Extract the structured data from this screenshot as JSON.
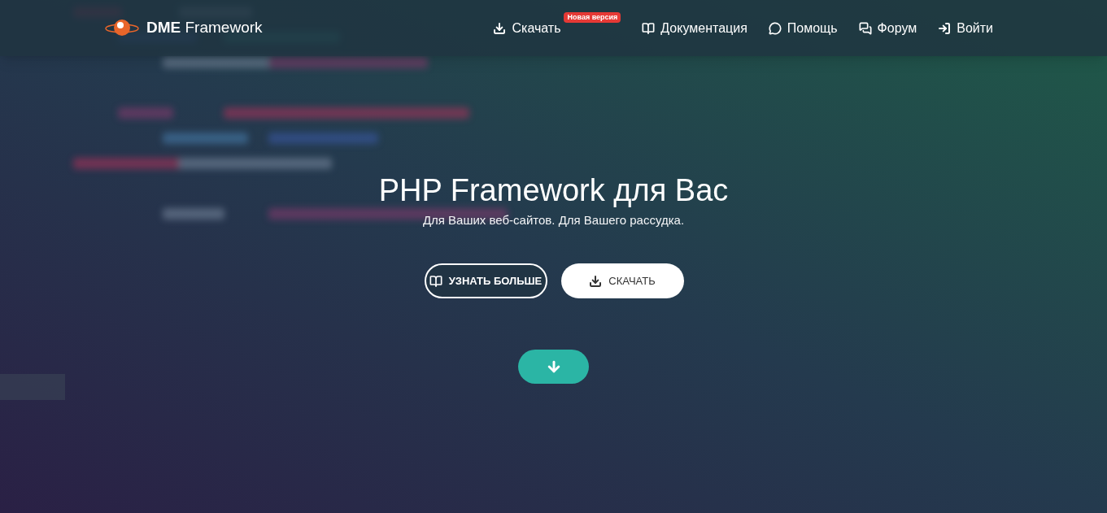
{
  "brand": {
    "name": "**DME** Framework"
  },
  "nav": [
    {
      "kind": "download",
      "label": "Скачать",
      "badge": "Новая версия"
    },
    {
      "kind": "book",
      "label": "Документация"
    },
    {
      "kind": "comment",
      "label": "Помощь"
    },
    {
      "kind": "comments",
      "label": "Форум"
    },
    {
      "kind": "login",
      "label": "Войти"
    }
  ],
  "hero": {
    "title": "PHP Framework для Вас",
    "subtitle": "Для Ваших веб-сайтов. Для Вашего рассудка.",
    "buttons": [
      {
        "kind": "book",
        "label": "УЗНАТЬ БОЛЬШЕ"
      },
      {
        "kind": "download",
        "label": "СКАЧАТЬ"
      }
    ]
  }
}
